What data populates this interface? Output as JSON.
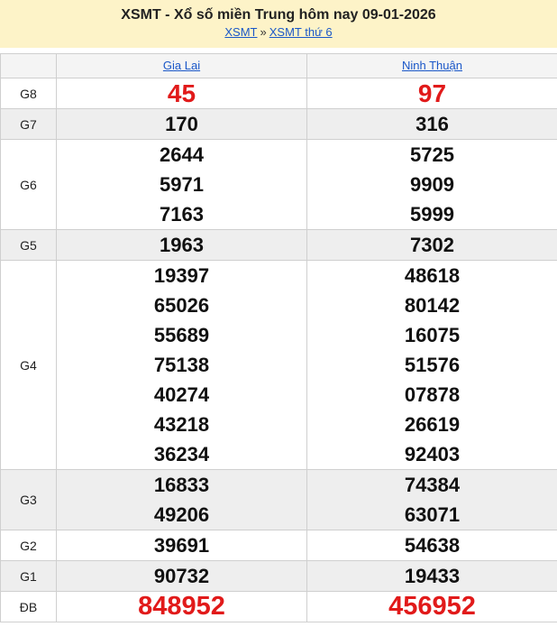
{
  "header": {
    "title": "XSMT - Xổ số miền Trung hôm nay 09-01-2026",
    "crumb1": "XSMT",
    "sep": "»",
    "crumb2": "XSMT thứ 6"
  },
  "provinces": [
    "Gia Lai",
    "Ninh Thuận"
  ],
  "rows": [
    {
      "label": "G8",
      "gialai": [
        "45"
      ],
      "ninhthuan": [
        "97"
      ]
    },
    {
      "label": "G7",
      "gialai": [
        "170"
      ],
      "ninhthuan": [
        "316"
      ]
    },
    {
      "label": "G6",
      "gialai": [
        "2644",
        "5971",
        "7163"
      ],
      "ninhthuan": [
        "5725",
        "9909",
        "5999"
      ]
    },
    {
      "label": "G5",
      "gialai": [
        "1963"
      ],
      "ninhthuan": [
        "7302"
      ]
    },
    {
      "label": "G4",
      "gialai": [
        "19397",
        "65026",
        "55689",
        "75138",
        "40274",
        "43218",
        "36234"
      ],
      "ninhthuan": [
        "48618",
        "80142",
        "16075",
        "51576",
        "07878",
        "26619",
        "92403"
      ]
    },
    {
      "label": "G3",
      "gialai": [
        "16833",
        "49206"
      ],
      "ninhthuan": [
        "74384",
        "63071"
      ]
    },
    {
      "label": "G2",
      "gialai": [
        "39691"
      ],
      "ninhthuan": [
        "54638"
      ]
    },
    {
      "label": "G1",
      "gialai": [
        "90732"
      ],
      "ninhthuan": [
        "19433"
      ]
    },
    {
      "label": "ĐB",
      "gialai": [
        "848952"
      ],
      "ninhthuan": [
        "456952"
      ]
    }
  ],
  "colors": {
    "header_bg": "#fdf3c8",
    "highlight": "#e11a1a",
    "link": "#1a57c8",
    "alt_row": "#eeeeee"
  }
}
